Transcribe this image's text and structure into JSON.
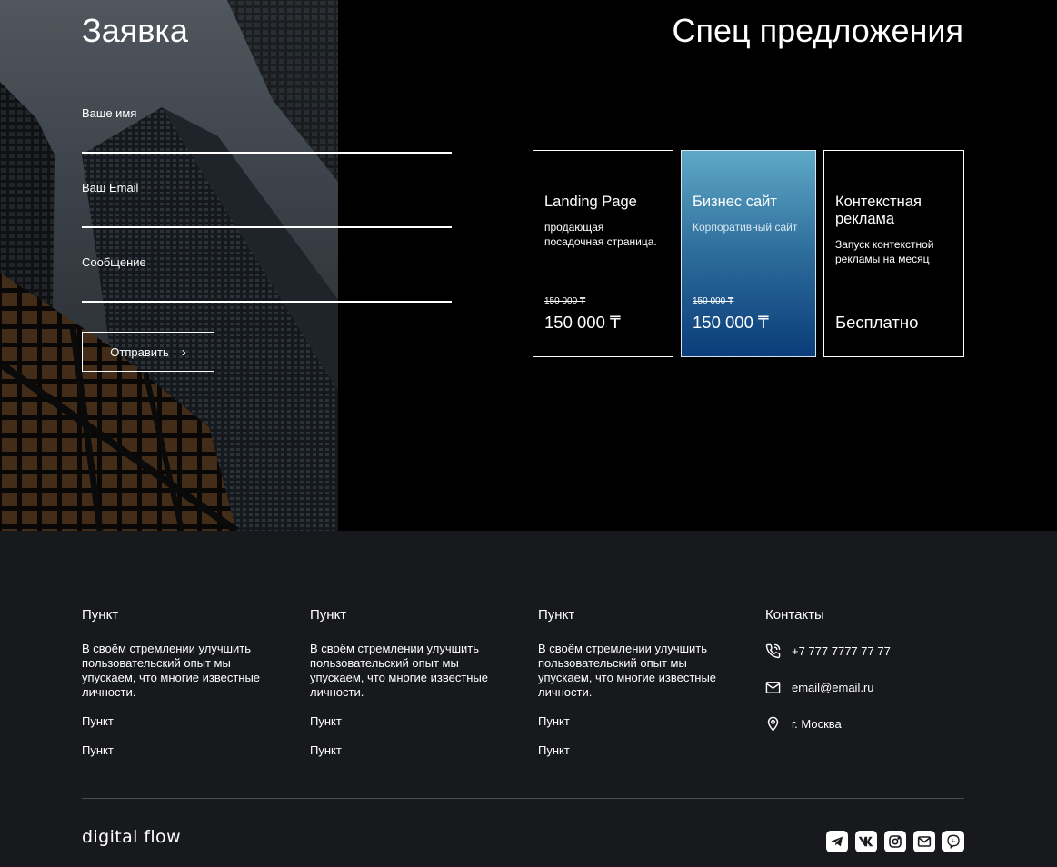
{
  "form": {
    "title": "Заявка",
    "name_label": "Ваше имя",
    "email_label": "Ваш Email",
    "message_label": "Сообщение",
    "submit_label": "Отправить"
  },
  "offers": {
    "title": "Спец предложения",
    "cards": [
      {
        "title": "Landing Page",
        "desc": "продающая посадочная страница.",
        "old_price": "150 000 ₸",
        "price": "150 000 ₸"
      },
      {
        "title": "Бизнес сайт",
        "desc": "Корпоративный сайт",
        "old_price": "150 000 ₸",
        "price": "150 000 ₸"
      },
      {
        "title": "Контекстная реклама",
        "desc": "Запуск контекстной рекламы на месяц",
        "old_price": "",
        "price": "Бесплатно"
      }
    ]
  },
  "footer": {
    "columns": [
      {
        "title": "Пункт",
        "text": "В своём стремлении улучшить пользовательский опыт мы упускаем, что многие известные личности.",
        "links": [
          "Пункт",
          "Пункт"
        ]
      },
      {
        "title": "Пункт",
        "text": "В своём стремлении улучшить пользовательский опыт мы упускаем, что многие известные личности.",
        "links": [
          "Пункт",
          "Пункт"
        ]
      },
      {
        "title": "Пункт",
        "text": "В своём стремлении улучшить пользовательский опыт мы упускаем, что многие известные личности.",
        "links": [
          "Пункт",
          "Пункт"
        ]
      }
    ],
    "contacts": {
      "title": "Контакты",
      "phone": "+7 777 7777 77 77",
      "email": "email@email.ru",
      "city": "г. Москва"
    },
    "brand": "digital flow",
    "social_icons": [
      "telegram-icon",
      "vk-icon",
      "instagram-icon",
      "mail-icon",
      "viber-icon"
    ]
  }
}
